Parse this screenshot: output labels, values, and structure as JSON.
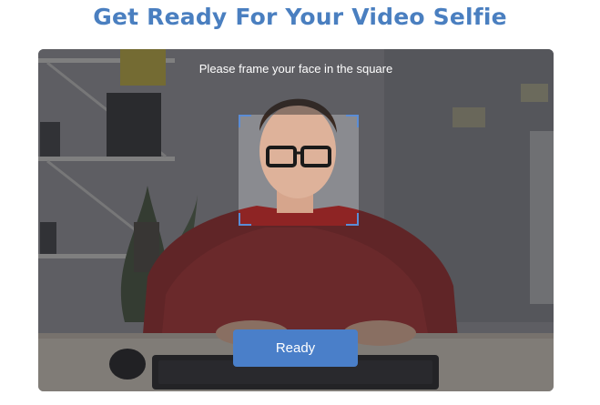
{
  "header": {
    "title": "Get Ready For Your Video Selfie"
  },
  "camera": {
    "instruction": "Please frame your face in the square",
    "ready_label": "Ready"
  },
  "colors": {
    "accent": "#4a7fc9",
    "title": "#4a7fc0",
    "frame": "#5b8dd6"
  }
}
